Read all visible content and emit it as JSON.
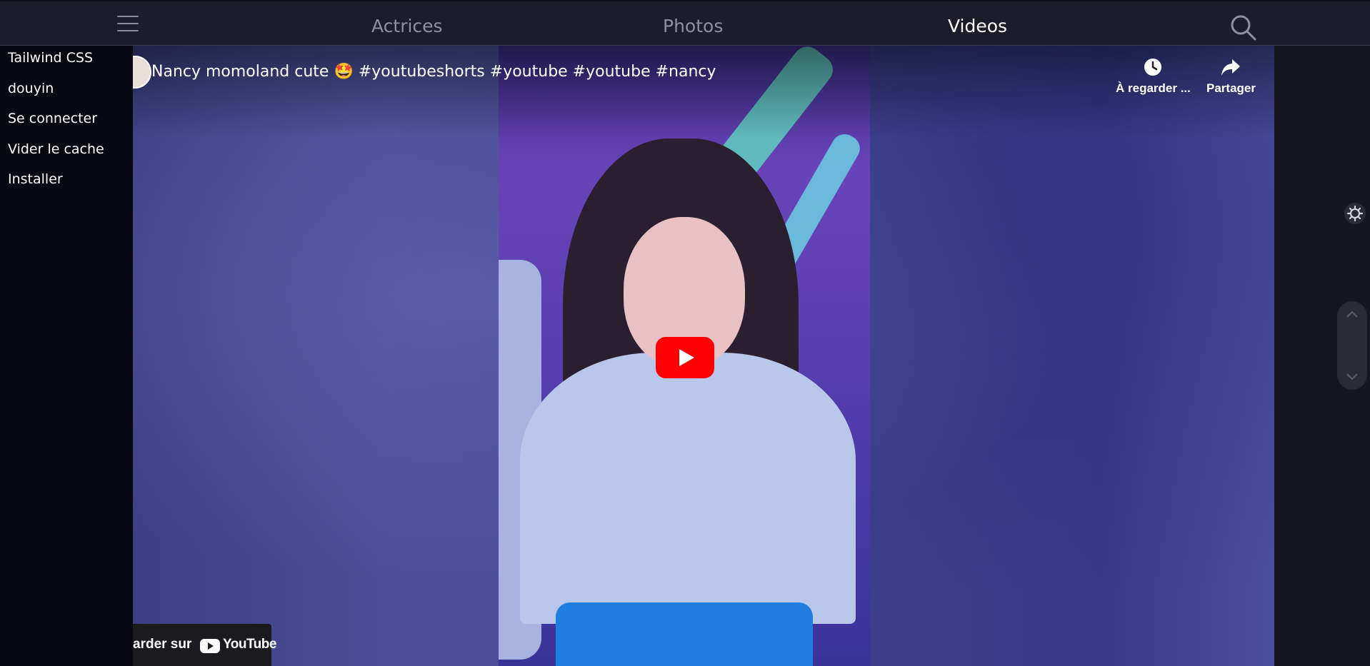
{
  "nav": {
    "items": [
      {
        "label": "Actrices"
      },
      {
        "label": "Photos"
      },
      {
        "label": "Videos"
      }
    ],
    "active": "Videos"
  },
  "sidebar": {
    "items": [
      {
        "label": "Tailwind CSS"
      },
      {
        "label": "douyin"
      },
      {
        "label": "Se connecter"
      },
      {
        "label": "Vider le cache"
      },
      {
        "label": "Installer"
      }
    ]
  },
  "video": {
    "title": "Nancy momoland cute 🤩 #youtubeshorts #youtube #youtube #nancy",
    "watch_later_label": "À regarder ...",
    "share_label": "Partager",
    "watch_on_label": "arder sur",
    "youtube_wordmark": "YouTube",
    "play_color": "#ff0000"
  },
  "icons": [
    "menu-icon",
    "search-icon",
    "clock-icon",
    "share-icon",
    "play-icon",
    "youtube-logo-icon",
    "gear-icon",
    "chevron-up-icon",
    "chevron-down-icon"
  ]
}
